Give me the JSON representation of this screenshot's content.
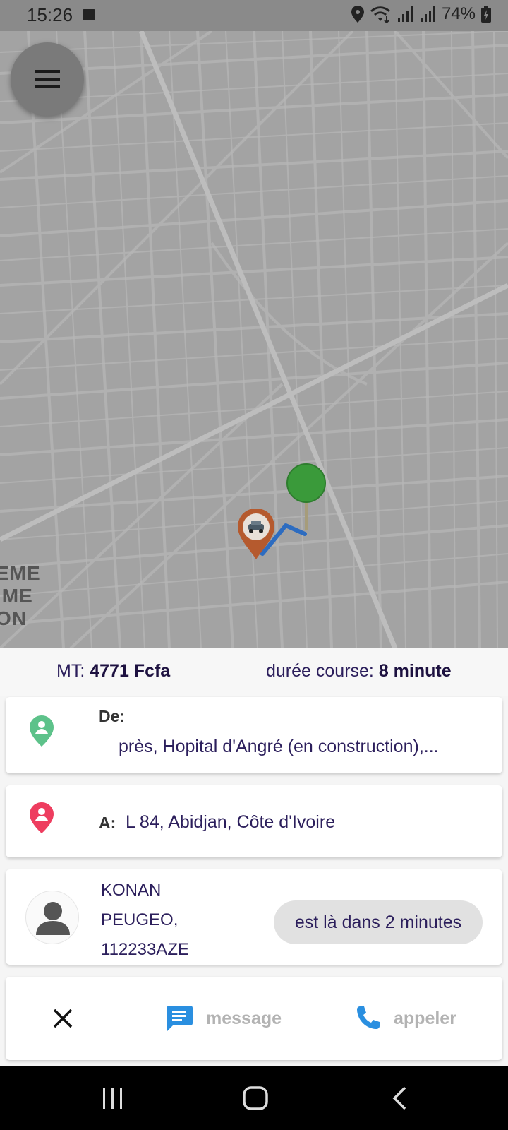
{
  "status_bar": {
    "time": "15:26",
    "battery": "74%",
    "icons": [
      "image-icon",
      "location-icon",
      "wifi-icon",
      "signal-icon",
      "signal-icon",
      "battery-charging-icon"
    ]
  },
  "map": {
    "labels": [
      "EME",
      "IME",
      "ON"
    ],
    "menu_icon": "hamburger-icon",
    "markers": [
      "car-pin-icon",
      "destination-pin-icon"
    ],
    "route_color": "#2d6cc0"
  },
  "trip_info": {
    "mt_label": "MT:",
    "mt_value": "4771 Fcfa",
    "duration_label": "durée course:",
    "duration_value": "8 minute"
  },
  "from": {
    "label": "De:",
    "address": "près, Hopital d'Angré (en construction),...",
    "icon": "pickup-pin-icon",
    "color": "#5dc28a"
  },
  "to": {
    "label": "A:",
    "address": "L 84, Abidjan, Côte d'Ivoire",
    "icon": "dropoff-pin-icon",
    "color": "#ee3d5f"
  },
  "driver": {
    "name": "KONAN",
    "car": "PEUGEO,",
    "plate": "112233AZE",
    "eta": "est là dans 2 minutes",
    "avatar_icon": "person-icon"
  },
  "actions": {
    "cancel_icon": "close-icon",
    "message_label": "message",
    "message_icon": "message-icon",
    "call_label": "appeler",
    "call_icon": "phone-icon",
    "accent": "#2a8fe0"
  },
  "nav_bar": {
    "icons": [
      "recents-icon",
      "home-icon",
      "back-icon"
    ]
  }
}
